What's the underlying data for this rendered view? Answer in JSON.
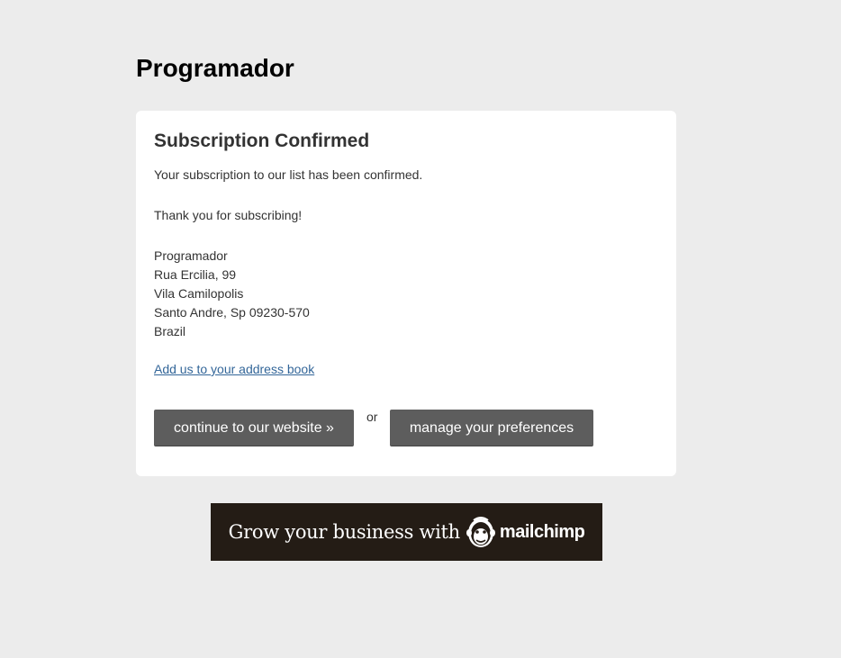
{
  "header": {
    "title": "Programador"
  },
  "card": {
    "title": "Subscription Confirmed",
    "message": "Your subscription to our list has been confirmed.",
    "thanks": "Thank you for subscribing!",
    "address": {
      "name": "Programador",
      "street": "Rua Ercilia, 99",
      "district": "Vila Camilopolis",
      "city": "Santo Andre, Sp 09230-570",
      "country": "Brazil"
    },
    "address_book_link": "Add us to your address book",
    "continue_button": "continue to our website »",
    "or_text": "or",
    "preferences_button": "manage your preferences"
  },
  "banner": {
    "text": "Grow your business with",
    "brand": "mailchimp",
    "icon": "mailchimp-freddie-icon",
    "background": "#241c15"
  },
  "colors": {
    "page_background": "#ececec",
    "button_background": "#5d5d5d",
    "link": "#336699"
  }
}
